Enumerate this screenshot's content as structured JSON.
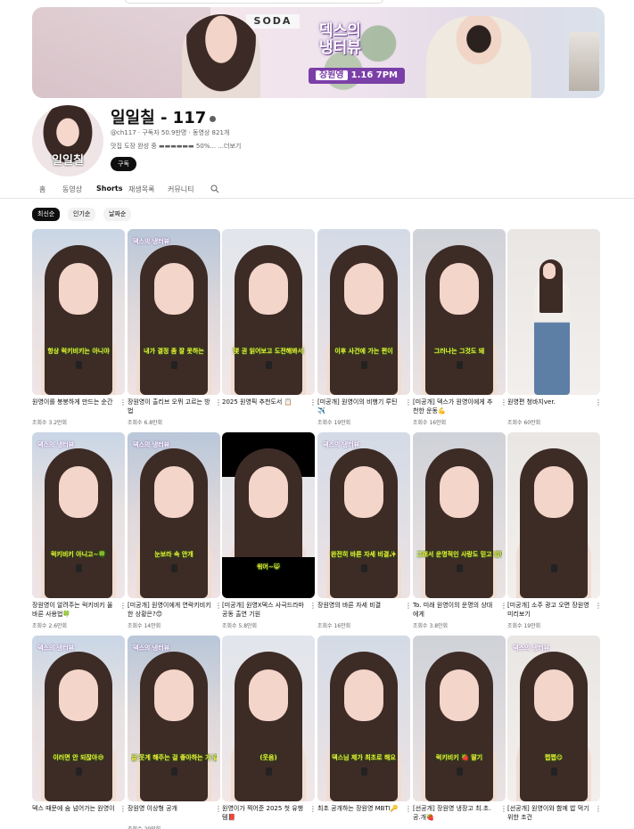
{
  "banner": {
    "sign": "SODA",
    "logo": "덱스의 냉터뷰",
    "guest": "장원영",
    "date": "1.16 7PM"
  },
  "channel": {
    "avatar_caption": "일일칠",
    "title": "일일칠 - 117",
    "meta": "@ch117 · 구독자 50.9만명 · 동영상 821개",
    "description": "맛집 도장 완성 중 ▬▬▬▬▬▬ 50%... ...더보기",
    "subscribe_label": "구독"
  },
  "tabs": [
    "홈",
    "동영상",
    "Shorts",
    "재생목록",
    "커뮤니티"
  ],
  "active_tab": "Shorts",
  "chips": [
    "최신순",
    "인기순",
    "날짜순"
  ],
  "active_chip": "최신순",
  "shorts": [
    {
      "title": "원영이를 붕붕하게 만드는 순간",
      "views": "조회수 3.2만회",
      "caption": "항상 럭키비키는 아니야"
    },
    {
      "title": "장원영이 출리브 오뮈 고르는 방법",
      "views": "조회수 6.8만회",
      "caption": "내가 결정 좀 잘 못하는"
    },
    {
      "title": "2025 원영픽 추천도서 📋",
      "views": "",
      "caption": "몇 권 읽어보고 도전해봐서"
    },
    {
      "title": "[미공개] 원영이의 비행기 루틴 ✈️",
      "views": "조회수 19만회",
      "caption": "이후 사건에 가는 편이"
    },
    {
      "title": "[미공개] 덱스가 원영이에게 추천한 운동💪",
      "views": "조회수 16만회",
      "caption": "그러나는 그것도 돼"
    },
    {
      "title": "원영편 청바지ver.",
      "views": "조회수 60만회",
      "caption": ""
    },
    {
      "title": "장원영이 알려주는 럭키비키 올바른 사용법🍀",
      "views": "조회수 2.6만회",
      "caption": "럭키비키 아니고~🍀"
    },
    {
      "title": "[미공개] 원영이에게 연락키비키한 상황은?😊",
      "views": "조회수 14만회",
      "caption": "눈보라 속 안개"
    },
    {
      "title": "[미공개] 원영X덱스 사극드라마 공동 출연 기원",
      "views": "조회수 5.8만회",
      "caption": "워어~😸"
    },
    {
      "title": "장원영의 바른 자세 비결",
      "views": "조회수 16만회",
      "caption": "완전히 바른 자세 비결✨"
    },
    {
      "title": "To. 미래 원영이의 운명의 상대에게",
      "views": "조회수 3.8만회",
      "caption": "그래서 운명적인 사랑도 믿고 있어"
    },
    {
      "title": "[미공개] 소주 광고 오면 장원영 미리보기",
      "views": "조회수 19만회",
      "caption": ""
    },
    {
      "title": "덱스 때문에 숨 넘어가는 원영이",
      "views": "",
      "caption": "이러면 안 되잖아😅"
    },
    {
      "title": "장원영 이상형 공개",
      "views": "조회수 29만회",
      "caption": "날 웃게 해주는 걸 좋아하는 거 같아"
    },
    {
      "title": "원영이가 찍어준 2025 첫 유행템📕",
      "views": "",
      "caption": "(웃음)"
    },
    {
      "title": "최초 공개하는 장원영 MBTI🔑",
      "views": "",
      "caption": "덱스님 제가 최초로 해요"
    },
    {
      "title": "[선공개] 장원영 냉장고 최.초.공.개🍓",
      "views": "",
      "caption": "럭키비키 🍓 딸기"
    },
    {
      "title": "[선공개] 원영이와 함께 밥 먹기 위한 조건",
      "views": "",
      "caption": "쩝쩝😋"
    }
  ],
  "colors": {
    "accent": "#0f0f0f",
    "caption_yellow": "#ffe93a",
    "logo_purple": "#7b3fa8"
  }
}
